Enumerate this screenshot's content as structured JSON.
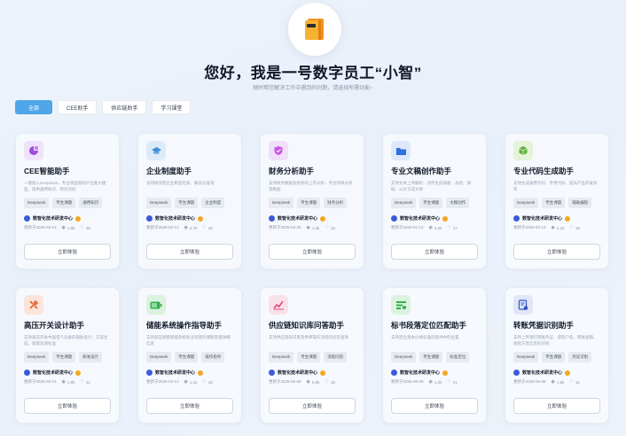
{
  "header": {
    "title": "您好，我是一号数字员工“小智”",
    "subtitle": "随时帮您解决工作中遇到的问题，请选择所需功能~"
  },
  "tabs": [
    {
      "label": "全部",
      "active": true
    },
    {
      "label": "CEE助手",
      "active": false
    },
    {
      "label": "供应链助手",
      "active": false
    },
    {
      "label": "学习课堂",
      "active": false
    }
  ],
  "cards": [
    {
      "title": "CEE智能助手",
      "desc": "一键接入Deepseek，专业调度帮助产业集大模型，提供通用知识、政务识别",
      "tags": [
        "Deepseek",
        "专生课题",
        "通用知识"
      ],
      "dept": "数智化技术研发中心",
      "date": "更新于2025-02-13",
      "views": "1.8k",
      "likes": "35",
      "icon": "robot-icon",
      "icon_bg": "#efe3fb",
      "icon_color": "#9b4de0"
    },
    {
      "title": "企业制度助手",
      "desc": "支持研究院企业制度检索、解读与查询",
      "tags": [
        "Deepseek",
        "专生课题",
        "企业制度"
      ],
      "dept": "数智化技术研发中心",
      "date": "更新于2025-02-13",
      "views": "3.7k",
      "likes": "20",
      "icon": "graduation-cap-icon",
      "icon_bg": "#dcebf9",
      "icon_color": "#3b8fd9"
    },
    {
      "title": "财务分析助手",
      "desc": "支持财务数据及财务的上市分析、专注项目分析等数据",
      "tags": [
        "Deepseek",
        "专生课题",
        "财务分析"
      ],
      "dept": "数智化技术研发中心",
      "date": "更新于2025-02-25",
      "views": "1.3k",
      "likes": "15",
      "icon": "shield-icon",
      "icon_bg": "#f1defa",
      "icon_color": "#c45ae0"
    },
    {
      "title": "专业文稿创作助手",
      "desc": "支持文本上传解析、创作生成调板、总结、调研、公文写成文章",
      "tags": [
        "Deepseek",
        "专生课题",
        "文稿创作"
      ],
      "dept": "数智化技术研发中心",
      "date": "更新于2025-02-13",
      "views": "2.2k",
      "likes": "17",
      "icon": "folder-icon",
      "icon_bg": "#dde9fb",
      "icon_color": "#2f6fe0"
    },
    {
      "title": "专业代码生成助手",
      "desc": "支持生成通用代码、专用代码、提高产品开发效率",
      "tags": [
        "Deepseek",
        "专生课题",
        "辅助编程"
      ],
      "dept": "数智化技术研发中心",
      "date": "更新于2025-02-13",
      "views": "2.1k",
      "likes": "15",
      "icon": "cube-icon",
      "icon_bg": "#e5f3d8",
      "icon_color": "#5fb03b"
    },
    {
      "title": "高压开关设计助手",
      "desc": "支持高压开关中国电气设备的辅助设计，方案生成、提取资源标准",
      "tags": [
        "Deepseek",
        "专生课题",
        "研发设计"
      ],
      "dept": "数智化技术研发中心",
      "date": "更新于2025-02-13",
      "views": "1.9k",
      "likes": "41",
      "icon": "tools-icon",
      "icon_bg": "#fbe5da",
      "icon_color": "#e2622f"
    },
    {
      "title": "储能系统操作指导助手",
      "desc": "支持高压储能储能系统各业场景的储能管理详细信息",
      "tags": [
        "Deepseek",
        "专生课题",
        "操作指导"
      ],
      "dept": "数智化技术研发中心",
      "date": "更新于2025-02-13",
      "views": "1.1k",
      "likes": "26",
      "icon": "battery-icon",
      "icon_bg": "#daf2de",
      "icon_color": "#2fb04a"
    },
    {
      "title": "供应链知识库问答助手",
      "desc": "支持供应链知识库及供库操作流程的问答查询",
      "tags": [
        "Deepseek",
        "专生课题",
        "流程问答"
      ],
      "dept": "数智化技术研发中心",
      "date": "更新于2025-06-09",
      "views": "0.9k",
      "likes": "15",
      "icon": "chart-line-icon",
      "icon_bg": "#f9e1ea",
      "icon_color": "#e04a7a"
    },
    {
      "title": "标书段落定位匹配助手",
      "desc": "支持定位基本价格标准段落书中的位置",
      "tags": [
        "Deepseek",
        "专生课题",
        "标准定位"
      ],
      "dept": "数智化技术研发中心",
      "date": "更新于2025-06-09",
      "views": "1.3k",
      "likes": "21",
      "icon": "list-check-icon",
      "icon_bg": "#dcf3df",
      "icon_color": "#34b050"
    },
    {
      "title": "转账凭据识别助手",
      "desc": "支持上传银行转账凭证、提取户名、转账金额、收款方等信息的识别",
      "tags": [
        "Deepseek",
        "专生课题",
        "凭证识别"
      ],
      "dept": "数智化技术研发中心",
      "date": "更新于2025-06-09",
      "views": "1.6k",
      "likes": "11",
      "icon": "receipt-icon",
      "icon_bg": "#e0e6f8",
      "icon_color": "#3452c8"
    }
  ],
  "try_label": "立即体验"
}
